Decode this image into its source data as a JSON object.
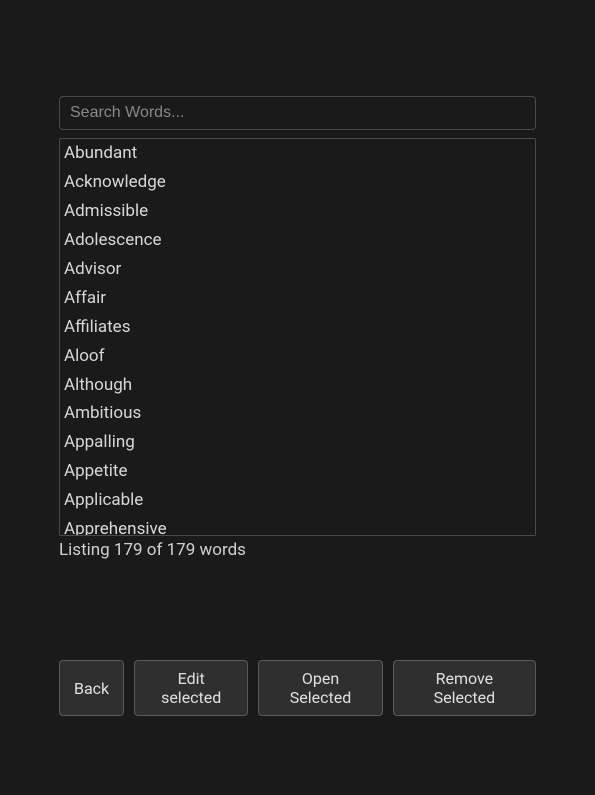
{
  "search": {
    "placeholder": "Search Words...",
    "value": ""
  },
  "words": [
    "Abundant",
    "Acknowledge",
    "Admissible",
    "Adolescence",
    "Advisor",
    "Affair",
    "Affiliates",
    "Aloof",
    "Although",
    "Ambitious",
    "Appalling",
    "Appetite",
    "Applicable",
    "Apprehensive"
  ],
  "status": {
    "text": "Listing 179 of 179 words",
    "shown": 179,
    "total": 179
  },
  "buttons": {
    "back": "Back",
    "edit": "Edit selected",
    "open": "Open Selected",
    "remove": "Remove Selected"
  }
}
